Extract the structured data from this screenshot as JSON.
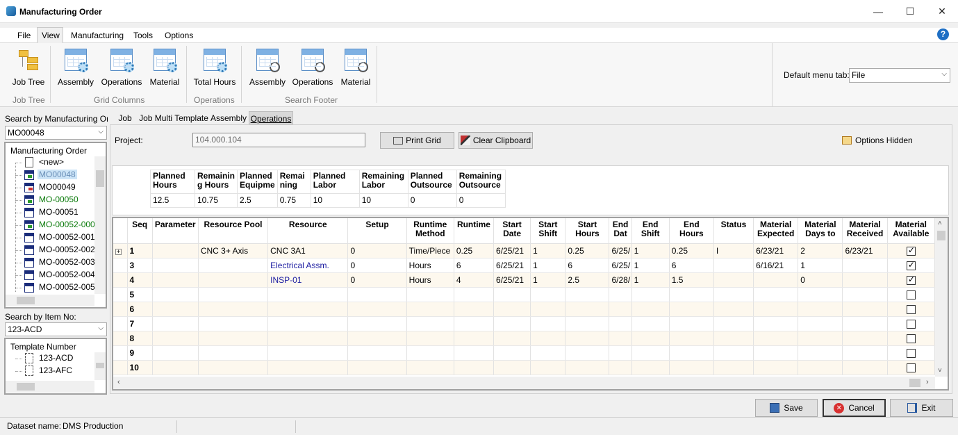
{
  "window": {
    "title": "Manufacturing Order",
    "minimize": "—",
    "maximize": "☐",
    "close": "✕"
  },
  "menu": {
    "file": "File",
    "view": "View",
    "manufacturing": "Manufacturing",
    "tools": "Tools",
    "options": "Options"
  },
  "ribbon": {
    "job_tree": "Job Tree",
    "grid_assembly": "Assembly",
    "grid_operations": "Operations",
    "grid_material": "Material",
    "total_hours": "Total Hours",
    "footer_assembly": "Assembly",
    "footer_operations": "Operations",
    "footer_material": "Material",
    "group_job_tree": "Job Tree",
    "group_grid_columns": "Grid Columns",
    "group_operations": "Operations",
    "group_search_footer": "Search Footer",
    "default_tab_label": "Default menu tab:",
    "default_tab_value": "File"
  },
  "left": {
    "search_mo_label": "Search by Manufacturing Orde",
    "search_mo_value": "MO00048",
    "mo_header": "Manufacturing Order",
    "mo_items": [
      {
        "label": "<new>"
      },
      {
        "label": "MO00048"
      },
      {
        "label": "MO00049"
      },
      {
        "label": "MO-00050"
      },
      {
        "label": "MO-00051"
      },
      {
        "label": "MO-00052-000"
      },
      {
        "label": "MO-00052-001"
      },
      {
        "label": "MO-00052-002"
      },
      {
        "label": "MO-00052-003"
      },
      {
        "label": "MO-00052-004"
      },
      {
        "label": "MO-00052-005"
      }
    ],
    "search_item_label": "Search by Item No:",
    "search_item_value": "123-ACD",
    "template_header": "Template Number",
    "template_items": [
      {
        "label": "123-ACD"
      },
      {
        "label": "123-AFC"
      }
    ]
  },
  "tabs": {
    "job": "Job",
    "job_multi": "Job Multi Template",
    "assembly": "Assembly",
    "operations": "Operations"
  },
  "project": {
    "label": "Project:",
    "value": "104.000.104"
  },
  "buttons": {
    "print_grid": "Print Grid",
    "clear_clipboard": "Clear Clipboard",
    "options_hidden": "Options Hidden",
    "save": "Save",
    "cancel": "Cancel",
    "exit": "Exit"
  },
  "summary": {
    "headers": [
      "Planned Hours",
      "Remaining Hours",
      "Planned Equipment",
      "Remaining",
      "Planned Labor",
      "Remaining Labor",
      "Planned Outsource",
      "Remaining Outsource"
    ],
    "header_lines": [
      [
        "Planned",
        "Hours"
      ],
      [
        "Remainin",
        "g Hours"
      ],
      [
        "Planned",
        "Equipme"
      ],
      [
        "Remai",
        "ning"
      ],
      [
        "Planned",
        "Labor"
      ],
      [
        "Remaining",
        "Labor"
      ],
      [
        "Planned",
        "Outsource"
      ],
      [
        "Remaining",
        "Outsource"
      ]
    ],
    "values": [
      "12.5",
      "10.75",
      "2.5",
      "0.75",
      "10",
      "10",
      "0",
      "0"
    ]
  },
  "grid": {
    "headers": [
      [
        "Seq"
      ],
      [
        "Parameter"
      ],
      [
        "Resource Pool"
      ],
      [
        "Resource"
      ],
      [
        "Setup"
      ],
      [
        "Runtime",
        "Method"
      ],
      [
        "Runtime"
      ],
      [
        "Start",
        "Date"
      ],
      [
        "Start",
        "Shift"
      ],
      [
        "Start",
        "Hours"
      ],
      [
        "End",
        "Dat"
      ],
      [
        "End",
        "Shift"
      ],
      [
        "End Hours"
      ],
      [
        "Status"
      ],
      [
        "Material",
        "Expected"
      ],
      [
        "Material",
        "Days to"
      ],
      [
        "Material",
        "Received"
      ],
      [
        "Material",
        "Available"
      ]
    ],
    "rows": [
      {
        "expand": "+",
        "seq": "1",
        "parameter": "",
        "pool": "CNC 3+ Axis",
        "resource": "CNC 3A1",
        "setup": "0",
        "method": "Time/Piece",
        "runtime": "0.25",
        "start_date": "6/25/21",
        "start_shift": "1",
        "start_hours": "0.25",
        "end_date": "6/25/",
        "end_shift": "1",
        "end_hours": "0.25",
        "status": "I",
        "mat_expected": "6/23/21",
        "mat_days": "2",
        "mat_received": "6/23/21",
        "available": true
      },
      {
        "expand": "",
        "seq": "3",
        "parameter": "",
        "pool": "",
        "resource": "Electrical Assm.",
        "setup": "0",
        "method": "Hours",
        "runtime": "6",
        "start_date": "6/25/21",
        "start_shift": "1",
        "start_hours": "6",
        "end_date": "6/25/",
        "end_shift": "1",
        "end_hours": "6",
        "status": "",
        "mat_expected": "6/16/21",
        "mat_days": "1",
        "mat_received": "",
        "available": true
      },
      {
        "expand": "",
        "seq": "4",
        "parameter": "",
        "pool": "",
        "resource": "INSP-01",
        "setup": "0",
        "method": "Hours",
        "runtime": "4",
        "start_date": "6/25/21",
        "start_shift": "1",
        "start_hours": "2.5",
        "end_date": "6/28/",
        "end_shift": "1",
        "end_hours": "1.5",
        "status": "",
        "mat_expected": "",
        "mat_days": "0",
        "mat_received": "",
        "available": true
      },
      {
        "expand": "",
        "seq": "5",
        "parameter": "",
        "pool": "",
        "resource": "",
        "setup": "",
        "method": "",
        "runtime": "",
        "start_date": "",
        "start_shift": "",
        "start_hours": "",
        "end_date": "",
        "end_shift": "",
        "end_hours": "",
        "status": "",
        "mat_expected": "",
        "mat_days": "",
        "mat_received": "",
        "available": false
      },
      {
        "expand": "",
        "seq": "6",
        "parameter": "",
        "pool": "",
        "resource": "",
        "setup": "",
        "method": "",
        "runtime": "",
        "start_date": "",
        "start_shift": "",
        "start_hours": "",
        "end_date": "",
        "end_shift": "",
        "end_hours": "",
        "status": "",
        "mat_expected": "",
        "mat_days": "",
        "mat_received": "",
        "available": false
      },
      {
        "expand": "",
        "seq": "7",
        "parameter": "",
        "pool": "",
        "resource": "",
        "setup": "",
        "method": "",
        "runtime": "",
        "start_date": "",
        "start_shift": "",
        "start_hours": "",
        "end_date": "",
        "end_shift": "",
        "end_hours": "",
        "status": "",
        "mat_expected": "",
        "mat_days": "",
        "mat_received": "",
        "available": false
      },
      {
        "expand": "",
        "seq": "8",
        "parameter": "",
        "pool": "",
        "resource": "",
        "setup": "",
        "method": "",
        "runtime": "",
        "start_date": "",
        "start_shift": "",
        "start_hours": "",
        "end_date": "",
        "end_shift": "",
        "end_hours": "",
        "status": "",
        "mat_expected": "",
        "mat_days": "",
        "mat_received": "",
        "available": false
      },
      {
        "expand": "",
        "seq": "9",
        "parameter": "",
        "pool": "",
        "resource": "",
        "setup": "",
        "method": "",
        "runtime": "",
        "start_date": "",
        "start_shift": "",
        "start_hours": "",
        "end_date": "",
        "end_shift": "",
        "end_hours": "",
        "status": "",
        "mat_expected": "",
        "mat_days": "",
        "mat_received": "",
        "available": false
      },
      {
        "expand": "",
        "seq": "10",
        "parameter": "",
        "pool": "",
        "resource": "",
        "setup": "",
        "method": "",
        "runtime": "",
        "start_date": "",
        "start_shift": "",
        "start_hours": "",
        "end_date": "",
        "end_shift": "",
        "end_hours": "",
        "status": "",
        "mat_expected": "",
        "mat_days": "",
        "mat_received": "",
        "available": false
      }
    ]
  },
  "status": {
    "label": "Dataset name:",
    "value": "DMS Production"
  },
  "colors": {
    "link_blue": "#1a1aa0",
    "green": "#0a7a0a",
    "selected_bg": "#cce4f7"
  }
}
